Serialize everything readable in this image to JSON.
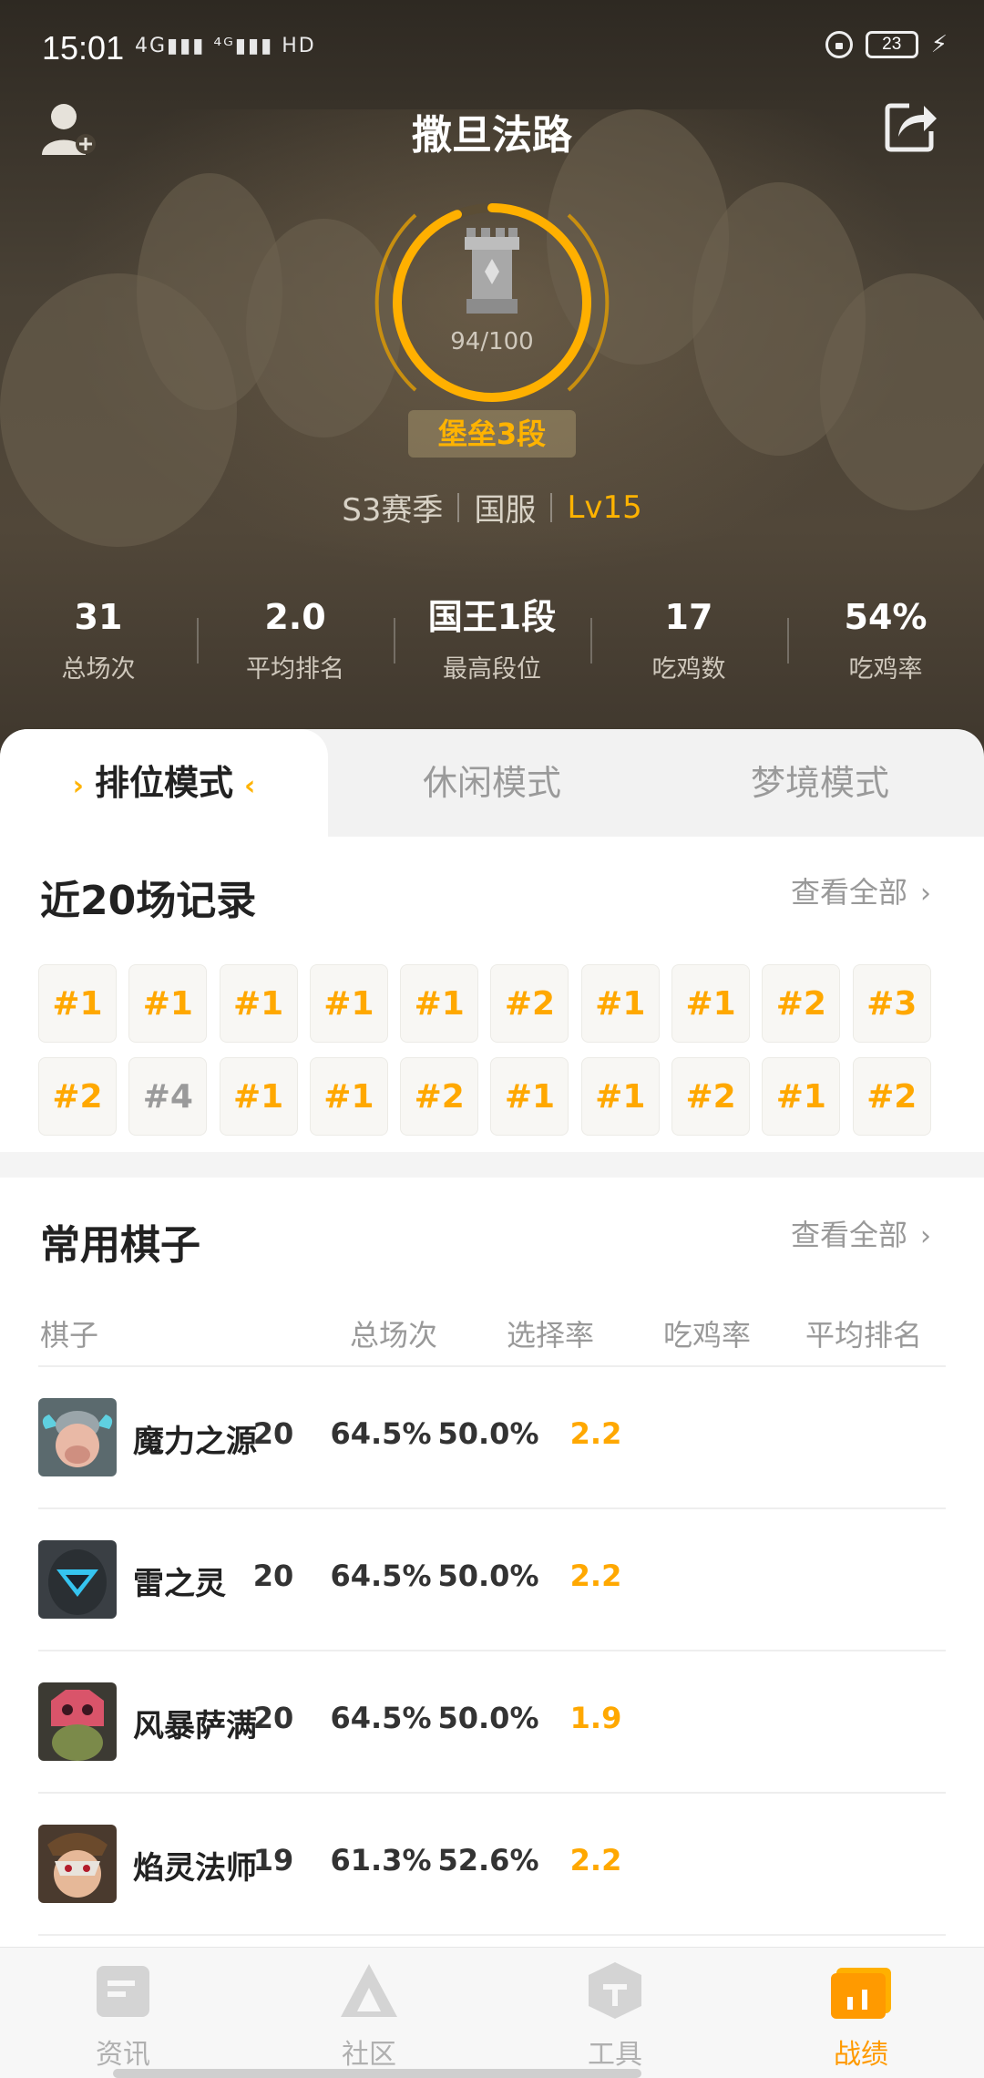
{
  "status_bar": {
    "time": "15:01",
    "signal": "4G▮▮▮ ⁴ᴳ▮▮▮ HD",
    "battery": "23"
  },
  "header": {
    "player_name": "撒旦法路",
    "rank_progress": "94/100",
    "rank_progress_fraction": 0.94,
    "rank_badge": "堡垒3段",
    "season": "S3赛季",
    "server": "国服",
    "level": "Lv15"
  },
  "stats": [
    {
      "value": "31",
      "label": "总场次"
    },
    {
      "value": "2.0",
      "label": "平均排名"
    },
    {
      "value": "国王1段",
      "label": "最高段位"
    },
    {
      "value": "17",
      "label": "吃鸡数"
    },
    {
      "value": "54%",
      "label": "吃鸡率"
    }
  ],
  "tabs": {
    "ranked": "排位模式",
    "casual": "休闲模式",
    "dream": "梦境模式"
  },
  "recent": {
    "title": "近20场记录",
    "view_all": "查看全部",
    "results": [
      "#1",
      "#1",
      "#1",
      "#1",
      "#1",
      "#2",
      "#1",
      "#1",
      "#2",
      "#3",
      "#2",
      "#4",
      "#1",
      "#1",
      "#2",
      "#1",
      "#1",
      "#2",
      "#1",
      "#2"
    ]
  },
  "pieces": {
    "title": "常用棋子",
    "view_all": "查看全部",
    "headers": {
      "name": "棋子",
      "games": "总场次",
      "pick_rate": "选择率",
      "win_rate": "吃鸡率",
      "avg_rank": "平均排名"
    },
    "rows": [
      {
        "name": "魔力之源",
        "games": "20",
        "pick_rate": "64.5%",
        "win_rate": "50.0%",
        "avg_rank": "2.2"
      },
      {
        "name": "雷之灵",
        "games": "20",
        "pick_rate": "64.5%",
        "win_rate": "50.0%",
        "avg_rank": "2.2"
      },
      {
        "name": "风暴萨满",
        "games": "20",
        "pick_rate": "64.5%",
        "win_rate": "50.0%",
        "avg_rank": "1.9"
      },
      {
        "name": "焰灵法师",
        "games": "19",
        "pick_rate": "61.3%",
        "win_rate": "52.6%",
        "avg_rank": "2.2"
      }
    ]
  },
  "bottom_nav": {
    "news": "资讯",
    "community": "社区",
    "tools": "工具",
    "records": "战绩"
  },
  "colors": {
    "accent": "#ffa800",
    "hero_bg": "#4a4236",
    "inactive_nav": "#b0b0b0"
  }
}
